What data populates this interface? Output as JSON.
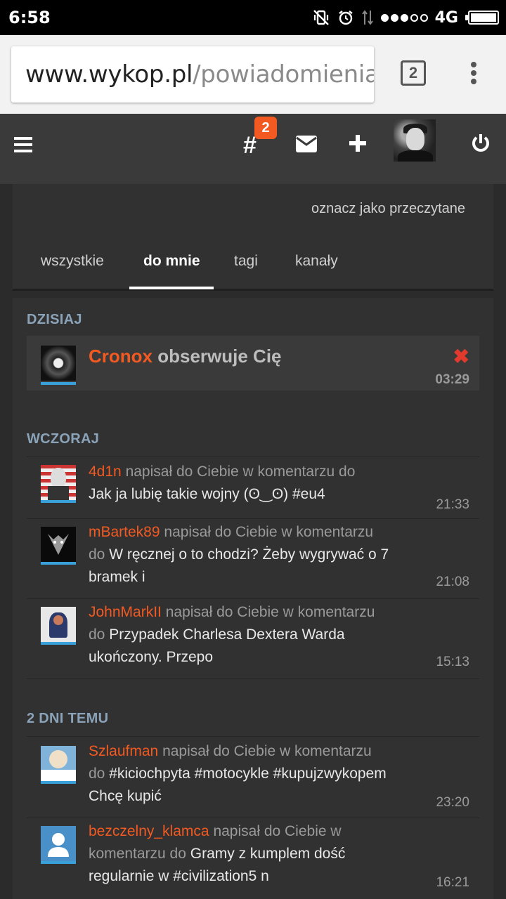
{
  "status_bar": {
    "time": "6:58",
    "network": "4G",
    "icons": [
      "vibrate-off-icon",
      "alarm-icon",
      "data-arrows-icon",
      "signal-dots-icon",
      "battery-icon"
    ]
  },
  "browser": {
    "url_host": "www.wykop.pl",
    "url_path": "/powiadomienia/",
    "tab_count": "2"
  },
  "header": {
    "hashtag_symbol": "#",
    "hashtag_badge": "2"
  },
  "notifications": {
    "mark_read": "oznacz jako przeczytane",
    "tabs": [
      {
        "label": "wszystkie",
        "active": false
      },
      {
        "label": "do mnie",
        "active": true
      },
      {
        "label": "tagi",
        "active": false
      },
      {
        "label": "kanały",
        "active": false
      }
    ],
    "sections": [
      {
        "label": "DZISIAJ",
        "items": [
          {
            "user": "Cronox",
            "action": "obserwuje Cię",
            "time": "03:29",
            "close": "✖"
          }
        ]
      },
      {
        "label": "WCZORAJ",
        "items": [
          {
            "user": "4d1n",
            "action_a": "napisał do Ciebie w komentarzu do",
            "action_b": "",
            "title": "Jak ja lubię takie wojny (ʘ‿ʘ) #eu4",
            "time": "21:33"
          },
          {
            "user": "mBartek89",
            "action_a": "napisał do Ciebie w komentarzu",
            "action_b": "do",
            "title": "W ręcznej o to chodzi? Żeby wygrywać o 7 bramek i",
            "time": "21:08"
          },
          {
            "user": "JohnMarkII",
            "action_a": "napisał do Ciebie w komentarzu",
            "action_b": "do",
            "title": "Przypadek Charlesa Dextera Warda ukończony. Przepo",
            "time": "15:13"
          }
        ]
      },
      {
        "label": "2 DNI TEMU",
        "items": [
          {
            "user": "Szlaufman",
            "action_a": "napisał do Ciebie w komentarzu",
            "action_b": "do",
            "title": "#kiciochpyta #motocykle #kupujzwykopem Chcę kupić",
            "time": "23:20"
          },
          {
            "user": "bezczelny_klamca",
            "action_a": "napisał do Ciebie w",
            "action_b": "komentarzu do",
            "title": "Gramy z kumplem dość regularnie w #civilization5 n",
            "time": "16:21"
          }
        ]
      }
    ]
  }
}
